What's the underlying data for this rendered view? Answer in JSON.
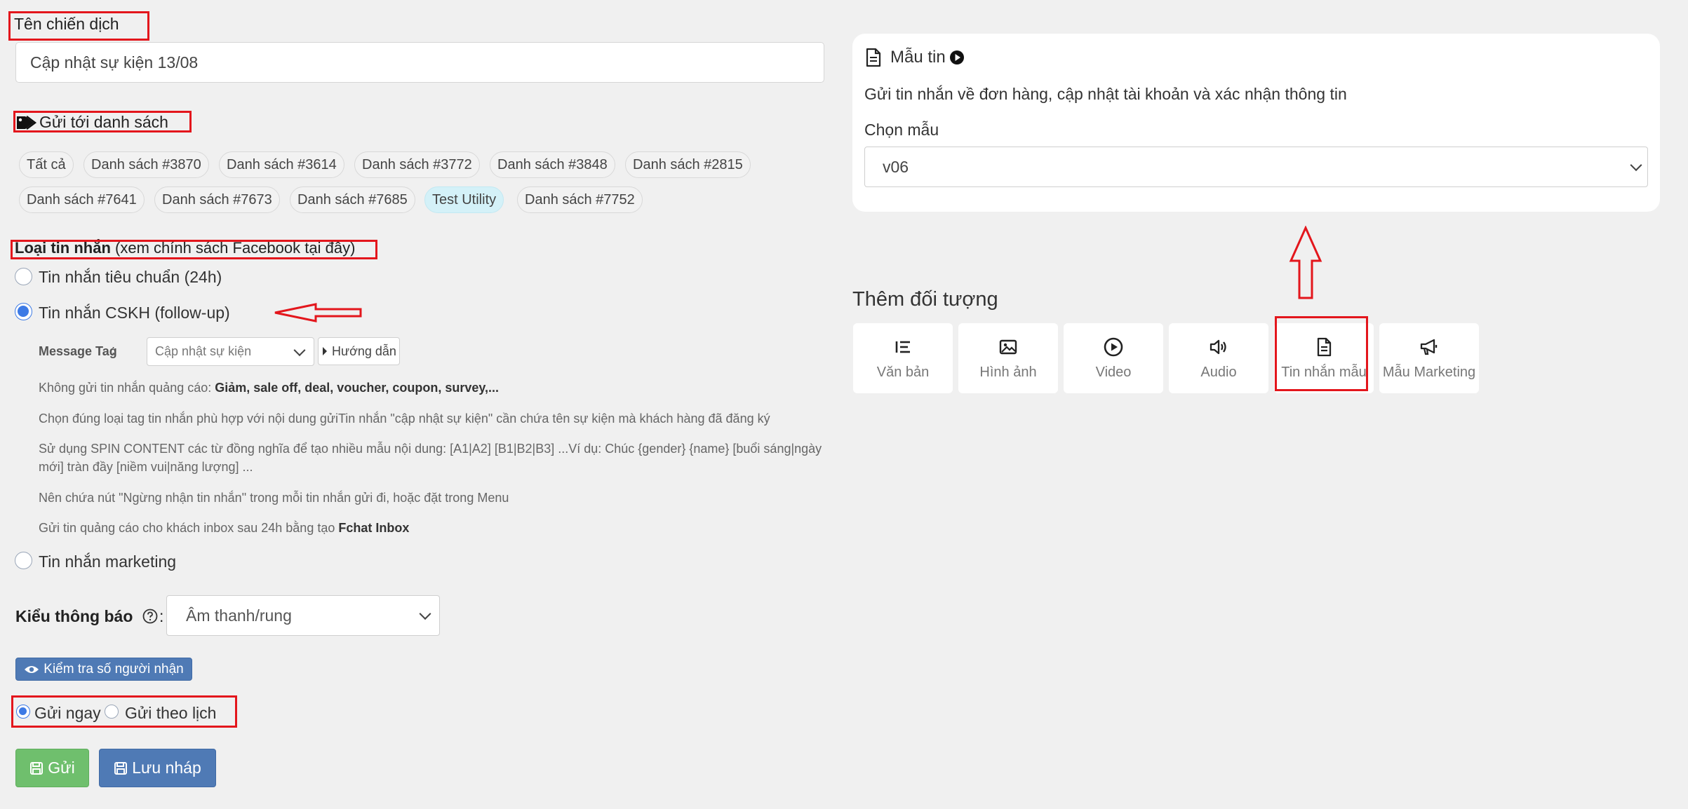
{
  "campaign": {
    "name_label": "Tên chiến dịch",
    "name_value": "Cập nhật sự kiện 13/08"
  },
  "send_to": {
    "label": "Gửi tới danh sách",
    "icon": "tag-icon",
    "lists": [
      "Tất cả",
      "Danh sách #3870",
      "Danh sách #3614",
      "Danh sách #3772",
      "Danh sách #3848",
      "Danh sách #2815",
      "Danh sách #7641",
      "Danh sách #7673",
      "Danh sách #7685",
      "Test Utility",
      "Danh sách #7752"
    ],
    "active": "Test Utility"
  },
  "message_type": {
    "label_bold": "Loại tin nhắn",
    "label_rest": " (xem chính sách Facebook tại đây)",
    "options": {
      "standard": "Tin nhắn tiêu chuẩn (24h)",
      "cskh": "Tin nhắn CSKH (follow-up)",
      "marketing": "Tin nhắn marketing"
    },
    "selected": "cskh",
    "message_tag_label": "Message Tag",
    "message_tag_value": "Cập nhật sự kiện",
    "guide_button": "Hướng dẫn",
    "notes": {
      "n1_prefix": "Không gửi tin nhắn quảng cáo: ",
      "n1_bold": "Giảm, sale off, deal, voucher, coupon, survey,...",
      "n2": " Chọn đúng loại tag tin nhắn phù hợp với nội dung gửiTin nhắn \"cập nhật sự kiện\" cần chứa tên sự kiện mà khách hàng đã đăng ký",
      "n3_line1": "Sử dụng SPIN CONTENT các từ đồng nghĩa để tạo nhiều mẫu nội dung: [A1|A2] [B1|B2|B3] ...Ví dụ: Chúc {gender} {name} [buổi sáng|ngày",
      "n3_line2": "mới] tràn đầy [niềm vui|năng lượng] ...",
      "n4": "Nên chứa nút \"Ngừng nhận tin nhắn\" trong mỗi tin nhắn gửi đi, hoặc đặt trong Menu",
      "n5_prefix": "Gửi tin quảng cáo cho khách inbox sau 24h bằng tạo ",
      "n5_bold": "Fchat Inbox"
    }
  },
  "notify": {
    "label": "Kiểu thông báo",
    "help_icon": "help-circle-icon",
    "colon": ":",
    "value": "Âm thanh/rung"
  },
  "check_button": "Kiểm tra số người nhận",
  "schedule": {
    "now": "Gửi ngay",
    "later": "Gửi theo lịch",
    "selected": "now"
  },
  "actions": {
    "send": "Gửi",
    "draft": "Lưu nháp"
  },
  "template_card": {
    "title": "Mẫu tin",
    "description": "Gửi tin nhắn về đơn hàng, cập nhật tài khoản và xác nhận thông tin",
    "choose_label": "Chọn mẫu",
    "choose_value": "v06"
  },
  "add_object": {
    "title": "Thêm đối tượng",
    "tiles": [
      {
        "label": "Văn bản",
        "icon": "text-list-icon"
      },
      {
        "label": "Hình ảnh",
        "icon": "image-icon"
      },
      {
        "label": "Video",
        "icon": "play-circle-icon"
      },
      {
        "label": "Audio",
        "icon": "volume-icon"
      },
      {
        "label": "Tin nhắn mẫu",
        "icon": "document-icon"
      },
      {
        "label": "Mẫu Marketing",
        "icon": "megaphone-icon"
      }
    ]
  },
  "colors": {
    "annotation": "#e3161c",
    "primary_blue": "#4f7ab5",
    "send_green": "#6fbf6d",
    "active_chip": "#d4f1f8"
  }
}
